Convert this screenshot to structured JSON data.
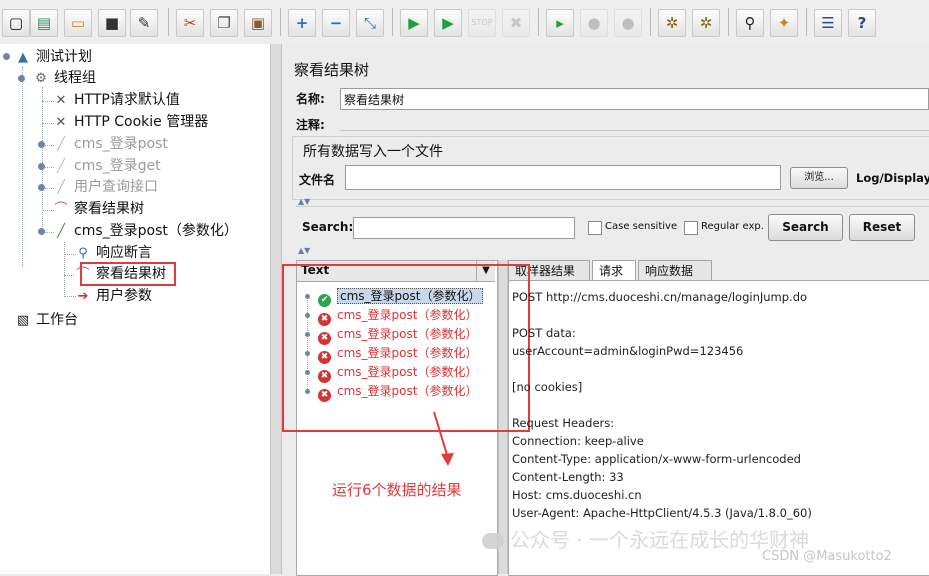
{
  "toolbar": {
    "buttons": [
      "new-icon",
      "templates-icon",
      "open-icon",
      "save-icon",
      "save-as-icon",
      "cut-icon",
      "copy-icon",
      "paste-icon",
      "expand-icon",
      "collapse-icon",
      "toggle-icon",
      "start-icon",
      "start-no-pause-icon",
      "stop-icon",
      "shutdown-icon",
      "remote-start-icon",
      "remote-stop-icon",
      "remote-exit-icon",
      "clear-icon",
      "clear-all-icon",
      "search-icon",
      "reset-search-icon",
      "function-helper-icon",
      "help-icon"
    ]
  },
  "tree": {
    "items": [
      {
        "label": "测试计划",
        "icon": "test-plan-icon"
      },
      {
        "label": "线程组",
        "icon": "thread-group-icon"
      },
      {
        "label": "HTTP请求默认值",
        "icon": "config-wrench-icon"
      },
      {
        "label": "HTTP Cookie 管理器",
        "icon": "config-wrench-icon"
      },
      {
        "label": "cms_登录post",
        "icon": "sampler-icon",
        "disabled": true
      },
      {
        "label": "cms_登录get",
        "icon": "sampler-icon",
        "disabled": true
      },
      {
        "label": "用户查询接口",
        "icon": "sampler-icon",
        "disabled": true
      },
      {
        "label": "察看结果树",
        "icon": "listener-icon"
      },
      {
        "label": "cms_登录post（参数化）",
        "icon": "sampler-icon"
      },
      {
        "label": "响应断言",
        "icon": "assertion-icon"
      },
      {
        "label": "察看结果树",
        "icon": "listener-icon"
      },
      {
        "label": "用户参数",
        "icon": "preprocessor-icon"
      },
      {
        "label": "工作台",
        "icon": "workbench-icon"
      }
    ]
  },
  "panel": {
    "title": "察看结果树",
    "name_label": "名称:",
    "name_value": "察看结果树",
    "comment_label": "注释:",
    "file_section_title": "所有数据写入一个文件",
    "filename_label": "文件名",
    "browse_label": "浏览...",
    "log_display_label": "Log/Display O",
    "search_label": "Search:",
    "case_sensitive_label": "Case sensitive",
    "regex_label": "Regular exp.",
    "search_button": "Search",
    "reset_button": "Reset",
    "renderer_value": "Text",
    "tabs": [
      "取样器结果",
      "请求",
      "响应数据"
    ],
    "active_tab": "请求"
  },
  "results": [
    {
      "label": "cms_登录post（参数化）",
      "status": "success"
    },
    {
      "label": "cms_登录post（参数化）",
      "status": "failure"
    },
    {
      "label": "cms_登录post（参数化）",
      "status": "failure"
    },
    {
      "label": "cms_登录post（参数化）",
      "status": "failure"
    },
    {
      "label": "cms_登录post（参数化）",
      "status": "failure"
    },
    {
      "label": "cms_登录post（参数化）",
      "status": "failure"
    }
  ],
  "request_lines": [
    "POST http://cms.duoceshi.cn/manage/loginJump.do",
    "",
    "POST data:",
    "userAccount=admin&loginPwd=123456",
    "",
    "[no cookies]",
    "",
    "Request Headers:",
    "Connection: keep-alive",
    "Content-Type: application/x-www-form-urlencoded",
    "Content-Length: 33",
    "Host: cms.duoceshi.cn",
    "User-Agent: Apache-HttpClient/4.5.3 (Java/1.8.0_60)"
  ],
  "annotation": {
    "text": "运行6个数据的结果",
    "color": "#e23b3b"
  },
  "watermark": {
    "wechat": "公众号 · 一个永远在成长的华财神",
    "csdn": "CSDN @Masukotto2"
  }
}
